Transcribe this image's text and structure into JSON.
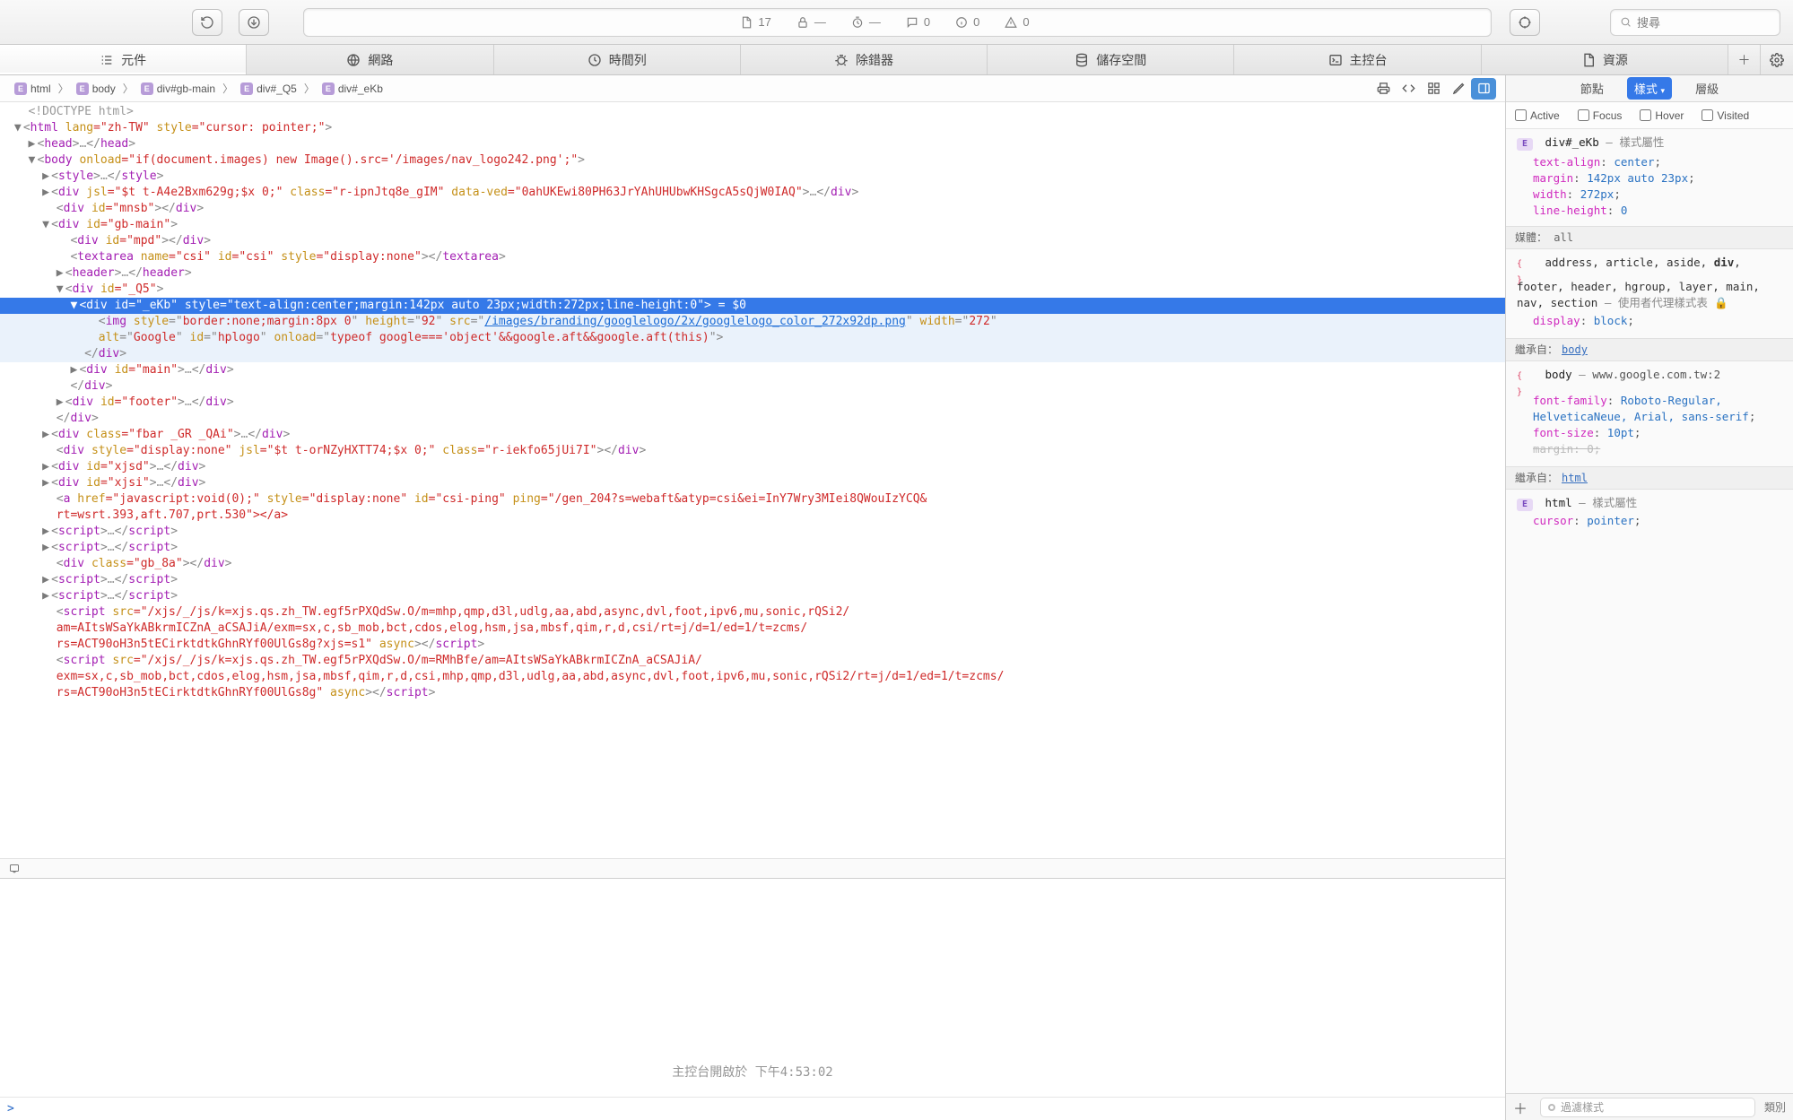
{
  "toolbar": {
    "resources_count": "17",
    "lock_text": "—",
    "timer_text": "—",
    "comments": "0",
    "info": "0",
    "warn": "0",
    "search_placeholder": "搜尋"
  },
  "tabs": {
    "elements": "元件",
    "network": "網路",
    "timeline": "時間列",
    "debugger": "除錯器",
    "storage": "儲存空間",
    "console": "主控台",
    "resources": "資源"
  },
  "breadcrumb": [
    {
      "label": "html"
    },
    {
      "label": "body"
    },
    {
      "label": "div#gb-main"
    },
    {
      "label": "div#_Q5"
    },
    {
      "label": "div#_eKb"
    }
  ],
  "dom": {
    "l0": "<!DOCTYPE html>",
    "l1_open": "<",
    "l1_tag": "html",
    "l1_attr1": " lang",
    "l1_val1": "=\"zh-TW\"",
    "l1_attr2": " style",
    "l1_val2": "=\"cursor: pointer;\"",
    "l1_close": ">",
    "head_open": "<head>",
    "head_ell": "…",
    "head_close": "</head>",
    "body_open": "<body ",
    "body_attr": "onload",
    "body_val": "=\"if(document.images) new Image().src='/images/nav_logo242.png';\"",
    "body_close": ">",
    "style1": "<style>…</style>",
    "div_jsl": "<div ",
    "div_jsl_a1": "jsl",
    "div_jsl_v1": "=\"$t t-A4e2Bxm629g;$x 0;\"",
    "div_jsl_a2": " class",
    "div_jsl_v2": "=\"r-ipnJtq8e_gIM\"",
    "div_jsl_a3": " data-ved",
    "div_jsl_v3": "=\"0ahUKEwi80PH63JrYAhUHUbwKHSgcA5sQjW0IAQ\"",
    "div_jsl_close": ">…</div>",
    "mnsb": "<div id=\"mnsb\"></div>",
    "gbmain_open": "<div id=\"gb-main\">",
    "mpd": "<div id=\"mpd\"></div>",
    "textarea": "<textarea name=\"csi\" id=\"csi\" style=\"display:none\"></textarea>",
    "header": "<header>…</header>",
    "q5_open": "<div id=\"_Q5\">",
    "sel_line": "<div id=\"_eKb\" style=\"text-align:center;margin:142px auto 23px;width:272px;line-height:0\">",
    "sel_suffix": " = $0",
    "img_pre": "<img style=\"",
    "img_style": "border:none;margin:8px 0",
    "img_mid1": "\" height=\"",
    "img_h": "92",
    "img_mid2": "\" src=\"",
    "img_src": "/images/branding/googlelogo/2x/googlelogo_color_272x92dp.png",
    "img_mid3": "\" width=\"",
    "img_w": "272",
    "img_line2a": "alt=\"",
    "img_alt": "Google",
    "img_line2b": "\" id=\"",
    "img_id": "hplogo",
    "img_line2c": "\" onload=\"",
    "img_onload": "typeof google==='object'&&google.aft&&google.aft(this)",
    "img_line2d": "\">",
    "close_div": "</div>",
    "main_div": "<div id=\"main\">…</div>",
    "footer_div": "<div id=\"footer\">…</div>",
    "fbar": "<div class=\"fbar _GR _QAi\">…</div>",
    "dispnone": "<div style=\"display:none\" jsl=\"$t t-orNZyHXTT74;$x 0;\" class=\"r-iekfo65jUi7I\"></div>",
    "xjsd": "<div id=\"xjsd\">…</div>",
    "xjsi": "<div id=\"xjsi\">…</div>",
    "a1": "<a href=\"javascript:void(0);\" style=\"display:none\" id=\"csi-ping\" ping=\"/gen_204?s=webaft&atyp=csi&ei=InY7Wry3MIei8QWouIzYCQ&",
    "a2": "rt=wsrt.393,aft.707,prt.530\"></a>",
    "script_plain": "<script>…</​script>",
    "gb8a": "<div class=\"gb_8a\"></div>",
    "longsrc1": "<script src=\"/xjs/_/js/k=xjs.qs.zh_TW.egf5rPXQdSw.O/m=mhp,qmp,d3l,udlg,aa,abd,async,dvl,foot,ipv6,mu,sonic,rQSi2/",
    "longsrc2": "am=AItsWSaYkABkrmICZnA_aCSAJiA/exm=sx,c,sb_mob,bct,cdos,elog,hsm,jsa,mbsf,qim,r,d,csi/rt=j/d=1/ed=1/t=zcms/",
    "longsrc3": "rs=ACT90oH3n5tECirktdtkGhnRYf00UlGs8g?xjs=s1\" async></​script>",
    "longsrc4": "<script src=\"/xjs/_/js/k=xjs.qs.zh_TW.egf5rPXQdSw.O/m=RMhBfe/am=AItsWSaYkABkrmICZnA_aCSAJiA/",
    "longsrc5": "exm=sx,c,sb_mob,bct,cdos,elog,hsm,jsa,mbsf,qim,r,d,csi,mhp,qmp,d3l,udlg,aa,abd,async,dvl,foot,ipv6,mu,sonic,rQSi2/rt=j/d=1/ed=1/t=zcms/",
    "longsrc6": "rs=ACT90oH3n5tECirktdtkGhnRYf00UlGs8g\" async></​script>"
  },
  "right": {
    "tabs": {
      "nodes": "節點",
      "styles": "樣式",
      "layers": "層級"
    },
    "pseudo": {
      "active": "Active",
      "focus": "Focus",
      "hover": "Hover",
      "visited": "Visited"
    },
    "rule1": {
      "selector": "div#_eKb",
      "origin": "— 樣式屬性",
      "p1": "text-align",
      "v1": "center",
      "p2": "margin",
      "v2": "142px auto 23px",
      "p3": "width",
      "v3": "272px",
      "p4": "line-height",
      "v4": "0"
    },
    "media_label": "媒體：",
    "media_val": "all",
    "ua_list": "address, article, aside, div, footer, header, hgroup, layer, main, nav, section",
    "ua_origin": " — 使用者代理樣式表",
    "ua_p1": "display",
    "ua_v1": "block",
    "inherit_body": "繼承自：",
    "body_link": "body",
    "body_sel": "body",
    "body_origin": " — ",
    "body_src": "www.google.com.tw:2",
    "body_p1": "font-family",
    "body_v1": "Roboto-Regular, HelveticaNeue, Arial, sans-serif",
    "body_p2": "font-size",
    "body_v2": "10pt",
    "body_p3": "margin",
    "body_v3": "0",
    "inherit_html": "繼承自：",
    "html_link": "html",
    "html_sel": "html",
    "html_origin": " — 樣式屬性",
    "html_p1": "cursor",
    "html_v1": "pointer",
    "filter_placeholder": "過濾樣式",
    "type_label": "類別"
  },
  "console": {
    "msg": "主控台開啟於 下午4:53:02",
    "prompt": ">"
  }
}
